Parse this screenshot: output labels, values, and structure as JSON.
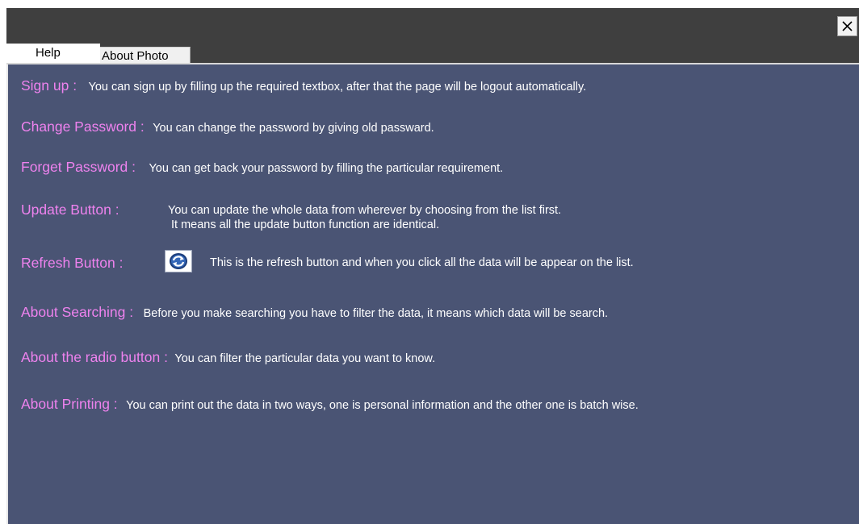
{
  "window": {
    "close_glyph": "✕"
  },
  "tabs": [
    {
      "label": "Help",
      "active": true
    },
    {
      "label": "About Photo",
      "active": false
    }
  ],
  "help_items": [
    {
      "label": "Sign up :",
      "description": "You can sign up by filling up the required textbox, after that the page will be logout automatically."
    },
    {
      "label": "Change Password :",
      "description": "You can change the password by giving old passward."
    },
    {
      "label": "Forget Password :",
      "description": "You can get back your password by filling the particular requirement."
    },
    {
      "label": "Update Button :",
      "description_lines": [
        "You can update the whole data from wherever by choosing from the list first.",
        "It means all the update button function are identical."
      ]
    },
    {
      "label": "Refresh Button :",
      "icon": "refresh-icon",
      "description": "This is the refresh button and when you click all the data will be appear on the list."
    },
    {
      "label": "About Searching :",
      "description": "Before you make searching you have to filter the data, it means which data will be search."
    },
    {
      "label": "About the radio button :",
      "description": "You can filter the particular data you want to know."
    },
    {
      "label": "About Printing :",
      "description": "You can print out the data in two ways, one is personal information and the other one is batch wise."
    }
  ],
  "colors": {
    "background": "#4a5474",
    "titlebar": "#3f3f3f",
    "label": "#ee82ee",
    "text": "#ffffff"
  }
}
